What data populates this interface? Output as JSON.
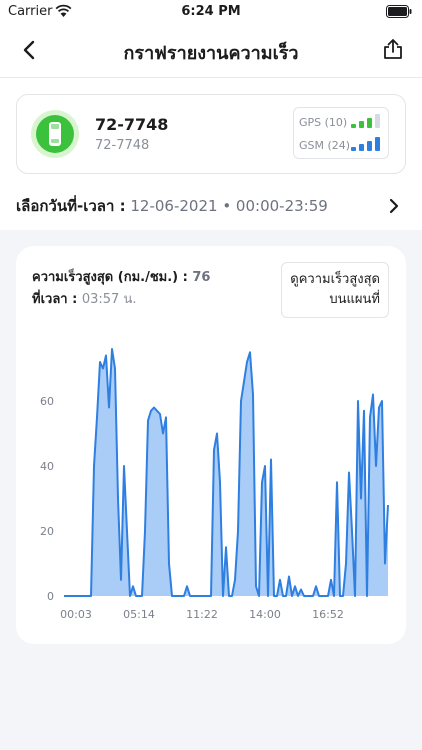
{
  "status": {
    "carrier": "Carrier",
    "time": "6:24 PM"
  },
  "nav": {
    "title": "กราฟรายงานความเร็ว"
  },
  "vehicle": {
    "plate": "72-7748",
    "plate_sub": "72-7748",
    "gps_label": "GPS",
    "gps_count": "(10)",
    "gsm_label": "GSM",
    "gsm_count": "(24)",
    "gps_level": 0.75,
    "gsm_level": 1.0
  },
  "date": {
    "label": "เลือกวันที่-เวลา :",
    "value": "12-06-2021 • 00:00-23:59"
  },
  "chart": {
    "max_speed_label": "ความเร็วสูงสุด (กม./ชม.) :",
    "max_speed_value": "76",
    "max_time_label": "ที่เวลา :",
    "max_time_value": "03:57 น.",
    "map_button_line1": "ดูความเร็วสูงสุด",
    "map_button_line2": "บนแผนที่"
  },
  "colors": {
    "accent": "#2f7fe0",
    "fill": "#a9cdf6",
    "green": "#3bc13b",
    "blue": "#2f7fe0"
  },
  "chart_data": {
    "type": "area",
    "title": "",
    "xlabel": "",
    "ylabel": "",
    "x_ticks": [
      "00:03",
      "05:14",
      "11:22",
      "14:00",
      "16:52"
    ],
    "y_ticks": [
      "0",
      "20",
      "40",
      "60"
    ],
    "ylim": [
      0,
      80
    ],
    "grid": false,
    "series": [
      {
        "values": [
          [
            0,
            0
          ],
          [
            9,
            0
          ],
          [
            10,
            40
          ],
          [
            11,
            55
          ],
          [
            12,
            72
          ],
          [
            13,
            70
          ],
          [
            14,
            74
          ],
          [
            15,
            58
          ],
          [
            16,
            76
          ],
          [
            17,
            70
          ],
          [
            18,
            30
          ],
          [
            19,
            5
          ],
          [
            20,
            40
          ],
          [
            21,
            20
          ],
          [
            22,
            0
          ],
          [
            23,
            3
          ],
          [
            24,
            0
          ],
          [
            25,
            0
          ],
          [
            26,
            0
          ],
          [
            27,
            20
          ],
          [
            28,
            54
          ],
          [
            29,
            57
          ],
          [
            30,
            58
          ],
          [
            31,
            57
          ],
          [
            32,
            56
          ],
          [
            33,
            50
          ],
          [
            34,
            55
          ],
          [
            35,
            10
          ],
          [
            36,
            0
          ],
          [
            37,
            0
          ],
          [
            38,
            0
          ],
          [
            39,
            0
          ],
          [
            40,
            0
          ],
          [
            41,
            3
          ],
          [
            42,
            0
          ],
          [
            43,
            0
          ],
          [
            44,
            0
          ],
          [
            45,
            0
          ],
          [
            46,
            0
          ],
          [
            47,
            0
          ],
          [
            48,
            0
          ],
          [
            49,
            0
          ],
          [
            50,
            45
          ],
          [
            51,
            50
          ],
          [
            52,
            35
          ],
          [
            53,
            0
          ],
          [
            54,
            15
          ],
          [
            55,
            0
          ],
          [
            56,
            0
          ],
          [
            57,
            5
          ],
          [
            58,
            20
          ],
          [
            59,
            60
          ],
          [
            60,
            66
          ],
          [
            61,
            72
          ],
          [
            62,
            75
          ],
          [
            63,
            62
          ],
          [
            64,
            3
          ],
          [
            65,
            0
          ],
          [
            66,
            35
          ],
          [
            67,
            40
          ],
          [
            68,
            0
          ],
          [
            69,
            42
          ],
          [
            70,
            0
          ],
          [
            71,
            0
          ],
          [
            72,
            5
          ],
          [
            73,
            0
          ],
          [
            74,
            0
          ],
          [
            75,
            6
          ],
          [
            76,
            0
          ],
          [
            77,
            3
          ],
          [
            78,
            0
          ],
          [
            79,
            2
          ],
          [
            80,
            0
          ],
          [
            81,
            0
          ],
          [
            82,
            0
          ],
          [
            83,
            0
          ],
          [
            84,
            3
          ],
          [
            85,
            0
          ],
          [
            86,
            0
          ],
          [
            87,
            0
          ],
          [
            88,
            0
          ],
          [
            89,
            5
          ],
          [
            90,
            0
          ],
          [
            91,
            35
          ],
          [
            92,
            0
          ],
          [
            93,
            0
          ],
          [
            94,
            10
          ],
          [
            95,
            38
          ],
          [
            96,
            20
          ],
          [
            97,
            0
          ],
          [
            98,
            60
          ],
          [
            99,
            30
          ],
          [
            100,
            57
          ],
          [
            101,
            0
          ],
          [
            102,
            55
          ],
          [
            103,
            62
          ],
          [
            104,
            40
          ],
          [
            105,
            58
          ],
          [
            106,
            60
          ],
          [
            107,
            10
          ],
          [
            108,
            28
          ]
        ]
      }
    ]
  }
}
